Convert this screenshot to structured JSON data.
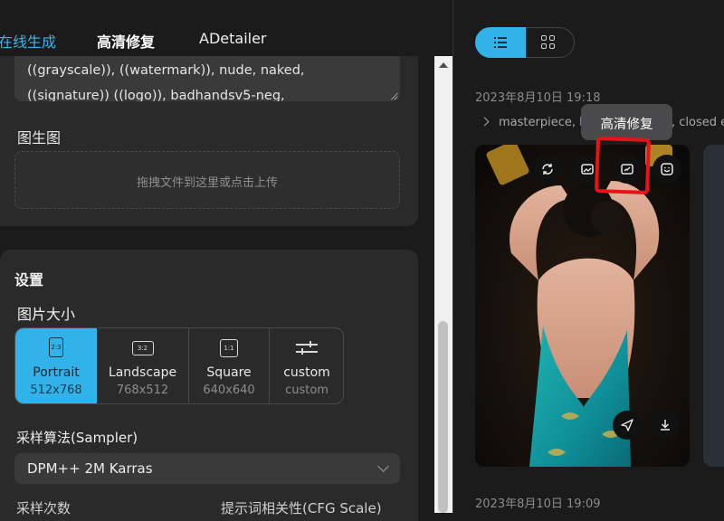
{
  "tabs": [
    {
      "label": "在线生成",
      "active": true
    },
    {
      "label": "高清修复",
      "active": false
    },
    {
      "label": "ADetailer",
      "active": false
    }
  ],
  "negative_prompt": {
    "line1": "((grayscale)), ((watermark)), nude, naked,",
    "line2": "((signature)) ((logo)), badhandsv5-neg,"
  },
  "img2img": {
    "label": "图生图",
    "upload_hint": "拖拽文件到这里或点击上传"
  },
  "settings": {
    "title": "设置",
    "size_label": "图片大小",
    "sizes": [
      {
        "icon_text": "2:3",
        "name": "Portrait",
        "dim": "512x768",
        "selected": true
      },
      {
        "icon_text": "3:2",
        "name": "Landscape",
        "dim": "768x512",
        "selected": false
      },
      {
        "icon_text": "1:1",
        "name": "Square",
        "dim": "640x640",
        "selected": false
      },
      {
        "icon_text": "",
        "name": "custom",
        "dim": "custom",
        "selected": false
      }
    ],
    "sampler_label": "采样算法(Sampler)",
    "sampler_value": "DPM++ 2M Karras",
    "steps_label_cut": "采样次数",
    "cfg_label_cut": "提示词相关性(CFG Scale)"
  },
  "gallery": {
    "view_modes": [
      "list-icon",
      "grid-icon"
    ],
    "active_view": "list",
    "entries": [
      {
        "date": "2023年8月10日 19:18",
        "prompt_start": "masterpiece, b",
        "prompt_tail": ", closed e"
      },
      {
        "date": "2023年8月10日 19:09"
      }
    ],
    "tooltip": "高清修复",
    "image_actions": [
      "regenerate-icon",
      "image-to-image-icon",
      "hires-fix-icon",
      "face-fix-icon"
    ],
    "bottom_actions": [
      "send-icon",
      "download-icon"
    ]
  },
  "colors": {
    "accent": "#31b2e8",
    "highlight_box": "#e8131a",
    "background": "#1b1b1c",
    "panel": "#2a2a2b"
  }
}
